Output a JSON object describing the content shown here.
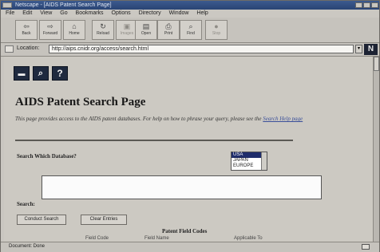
{
  "window": {
    "title": "Netscape - [AIDS Patent Search Page]"
  },
  "menu": [
    "File",
    "Edit",
    "View",
    "Go",
    "Bookmarks",
    "Options",
    "Directory",
    "Window",
    "Help"
  ],
  "toolbar": {
    "buttons": [
      {
        "label": "Back",
        "icon": "back-arrow-icon",
        "glyph": "⇦"
      },
      {
        "label": "Forward",
        "icon": "forward-arrow-icon",
        "glyph": "⇨"
      },
      {
        "label": "Home",
        "icon": "home-icon",
        "glyph": "⌂"
      },
      {
        "label": "Reload",
        "icon": "reload-icon",
        "glyph": "↻"
      },
      {
        "label": "Images",
        "icon": "images-icon",
        "glyph": "▣"
      },
      {
        "label": "Open",
        "icon": "open-icon",
        "glyph": "▤"
      },
      {
        "label": "Print",
        "icon": "print-icon",
        "glyph": "⎙"
      },
      {
        "label": "Find",
        "icon": "find-icon",
        "glyph": "⌕"
      },
      {
        "label": "Stop",
        "icon": "stop-icon",
        "glyph": "●"
      }
    ]
  },
  "location": {
    "label": "Location:",
    "url": "http://aips.cnidr.org/access/search.html"
  },
  "page": {
    "title": "AIDS Patent Search Page",
    "intro_text": "This page provides access to the AIDS patent databases. For help on how to phrase your query, please see the ",
    "intro_link": "Search Help page",
    "database_label": "Search Which Database?",
    "databases": [
      "USA",
      "JAPAN",
      "EUROPE"
    ],
    "selected_database": "USA",
    "search_label": "Search:",
    "search_value": "",
    "conduct_button": "Conduct Search",
    "clear_button": "Clear Entries",
    "field_codes_heading": "Patent Field Codes",
    "table_headers": [
      "Field Code",
      "Field Name",
      "Applicable To"
    ]
  },
  "status": {
    "message": "Document: Done"
  },
  "colors": {
    "title_bar": "#2a4474",
    "selection": "#1f2d6b",
    "link": "#3a4f9a"
  }
}
